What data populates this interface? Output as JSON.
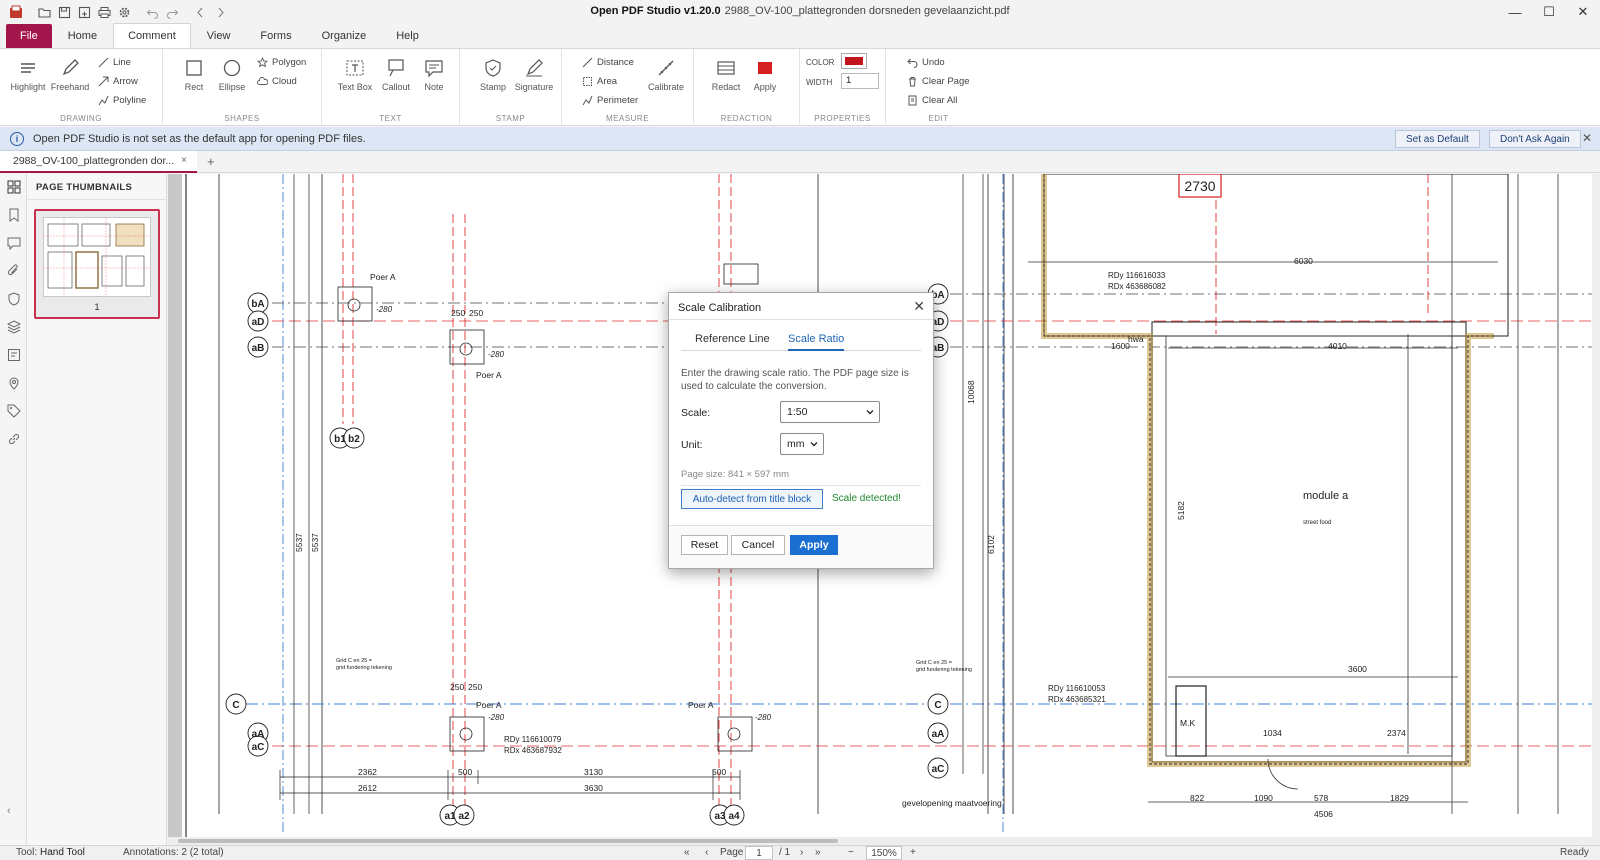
{
  "app": {
    "title": "Open PDF Studio v1.20.0",
    "filename": "2988_OV-100_plattegronden dorsneden gevelaanzicht.pdf"
  },
  "window_controls": {
    "minimize": "—",
    "maximize": "☐",
    "close": "✕"
  },
  "menu": {
    "tabs": [
      {
        "label": "File"
      },
      {
        "label": "Home"
      },
      {
        "label": "Comment",
        "active": true
      },
      {
        "label": "View"
      },
      {
        "label": "Forms"
      },
      {
        "label": "Organize"
      },
      {
        "label": "Help"
      }
    ]
  },
  "ribbon": {
    "groups": {
      "drawing": "DRAWING",
      "shapes": "SHAPES",
      "text": "TEXT",
      "stamp": "STAMP",
      "measure": "MEASURE",
      "redaction": "REDACTION",
      "properties": "PROPERTIES",
      "edit": "EDIT"
    },
    "drawing": {
      "highlight": "Highlight",
      "freehand": "Freehand",
      "line": "Line",
      "arrow": "Arrow",
      "polyline": "Polyline"
    },
    "shapes": {
      "rect": "Rect",
      "ellipse": "Ellipse",
      "polygon": "Polygon",
      "cloud": "Cloud"
    },
    "text": {
      "textbox": "Text Box",
      "callout": "Callout",
      "note": "Note"
    },
    "stamp": {
      "stamp": "Stamp",
      "signature": "Signature"
    },
    "measure": {
      "distance": "Distance",
      "area": "Area",
      "perimeter": "Perimeter",
      "calibrate": "Calibrate"
    },
    "redaction": {
      "redact": "Redact",
      "apply": "Apply"
    },
    "properties": {
      "color_label": "COLOR",
      "color_value": "#c0161c",
      "width_label": "WIDTH",
      "width_value": "1"
    },
    "edit": {
      "undo": "Undo",
      "clear_page": "Clear Page",
      "clear_all": "Clear All"
    }
  },
  "infobar": {
    "icon": "i",
    "message": "Open PDF Studio is not set as the default app for opening PDF files.",
    "set_default": "Set as Default",
    "dont_ask": "Don't Ask Again",
    "close": "✕"
  },
  "doc_tab": {
    "label": "2988_OV-100_plattegronden dor...",
    "close": "×",
    "add": "+"
  },
  "thumbnails": {
    "header": "PAGE THUMBNAILS",
    "pages": [
      {
        "number": "1"
      }
    ]
  },
  "drawing": {
    "labels": [
      "bA",
      "aD",
      "aB",
      "b1",
      "b2",
      "C",
      "aA",
      "aC",
      "bA",
      "aD",
      "aB",
      "C",
      "aA",
      "aC",
      "a1",
      "a2",
      "a3",
      "a4"
    ],
    "texts": {
      "room_number": "2730",
      "module": "module a",
      "module_sub": "street food",
      "poer": "Poer A",
      "rd1": "RDy 116616033",
      "rd1b": "RDx 463686082",
      "rd2": "RDy 116610079",
      "rd2b": "RDx 463687932",
      "rd3": "RDy 116610053",
      "rd3b": "RDx 463685321",
      "dim_6030": "6030",
      "dim_4010": "4010",
      "dim_1600": "1600",
      "dim_3600": "3600",
      "dim_2362": "2362",
      "dim_2612": "2612",
      "dim_3130": "3130",
      "dim_3630": "3630",
      "dim_500": "500",
      "dim_250": "250",
      "dim_280": "-280",
      "dim_2374": "2374",
      "dim_1034": "1034",
      "dim_822": "822",
      "dim_1090": "1090",
      "dim_578": "578",
      "dim_1829": "1829",
      "dim_4506": "4506",
      "dim_5182": "5182",
      "dim_10068": "10068",
      "dim_6102": "6102",
      "dim_5537": "5537",
      "gevel": "gevelopening maatvoering",
      "hwa": "hwa",
      "mk": "M.K",
      "note1": "Grid C en 25 =",
      "note2": "grid fundering tekening"
    }
  },
  "dialog": {
    "title": "Scale Calibration",
    "close": "✕",
    "tabs": [
      {
        "label": "Reference Line"
      },
      {
        "label": "Scale Ratio",
        "selected": true
      }
    ],
    "description": "Enter the drawing scale ratio. The PDF page size is used to calculate the conversion.",
    "scale_label": "Scale:",
    "scale_value": "1:50",
    "unit_label": "Unit:",
    "unit_value": "mm",
    "page_size": "Page size: 841 × 597 mm",
    "auto_detect": "Auto-detect from title block",
    "detected": "Scale detected!",
    "reset": "Reset",
    "cancel": "Cancel",
    "apply": "Apply"
  },
  "status": {
    "tool_label": "Tool:",
    "tool_value": "Hand Tool",
    "annotations": "Annotations: 2 (2 total)",
    "page_label": "Page",
    "page_value": "1",
    "page_total": "/ 1",
    "zoom": "150%",
    "zoom_minus": "−",
    "zoom_plus": "+",
    "ready": "Ready"
  }
}
